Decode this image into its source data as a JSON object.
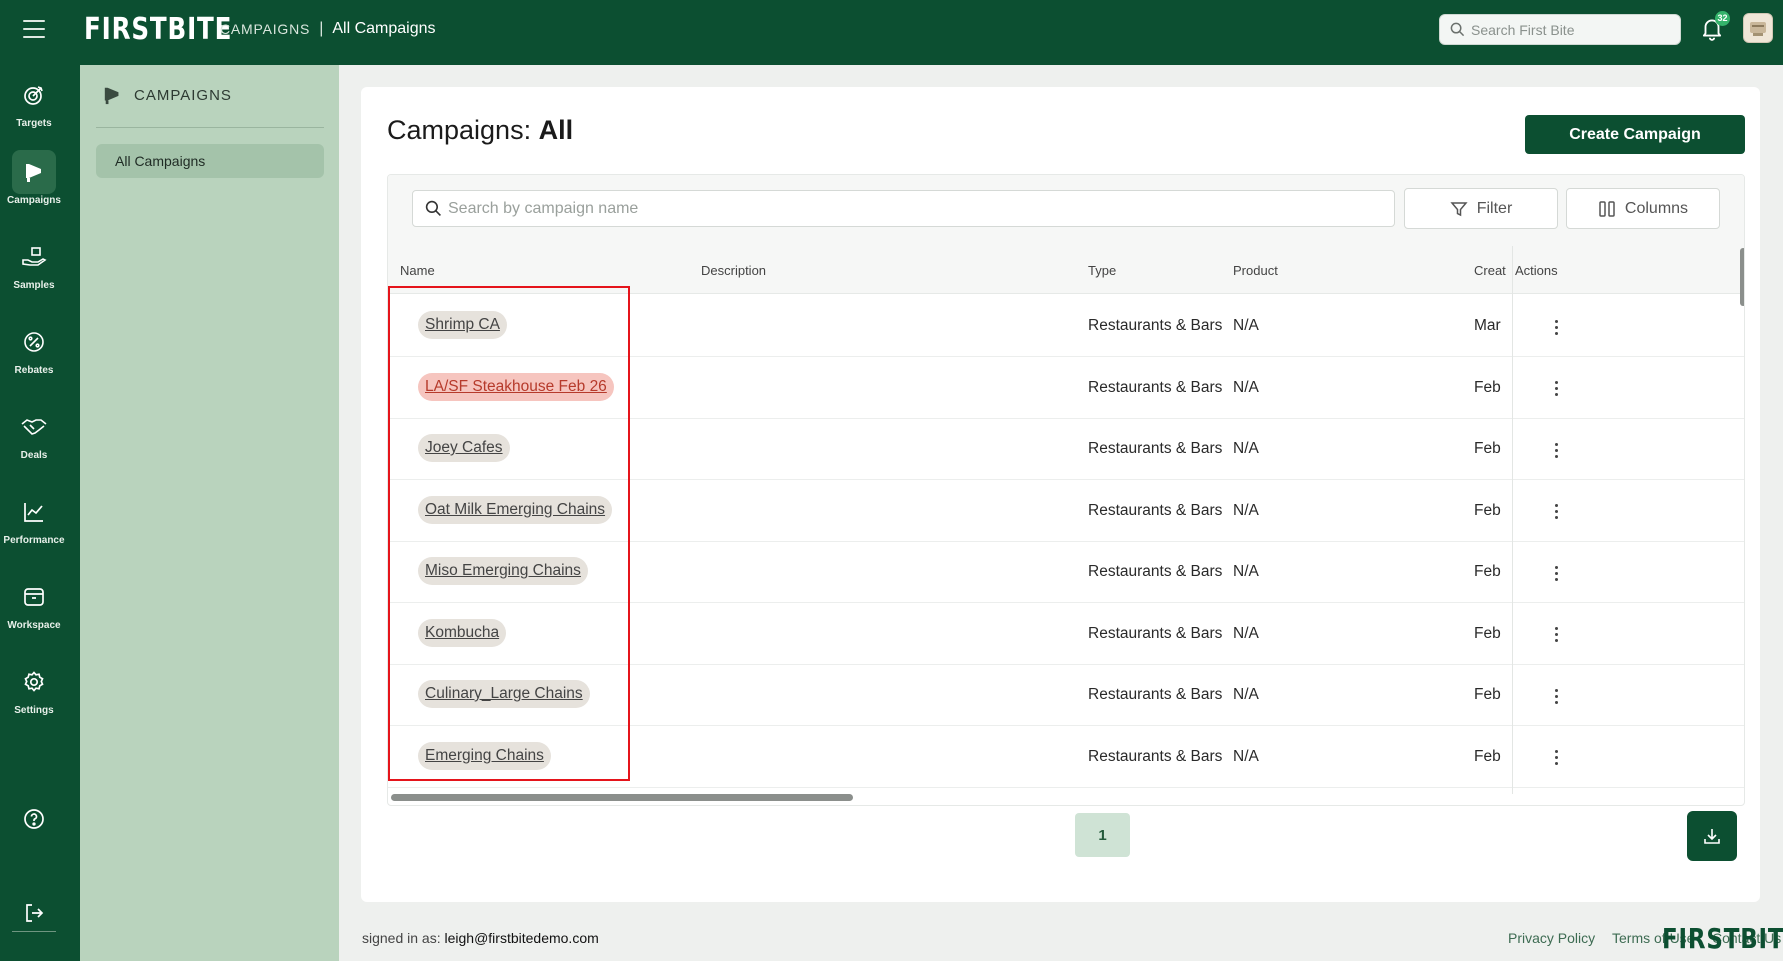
{
  "header": {
    "brand": "FIRSTBITE",
    "breadcrumb_section": "CAMPAIGNS",
    "breadcrumb_sep": "|",
    "breadcrumb_page": "All Campaigns",
    "search_placeholder": "Search First Bite",
    "notification_count": "32"
  },
  "rail": {
    "items": [
      {
        "label": "Targets",
        "icon": "target-icon"
      },
      {
        "label": "Campaigns",
        "icon": "megaphone-icon",
        "active": true
      },
      {
        "label": "Samples",
        "icon": "hand-box-icon"
      },
      {
        "label": "Rebates",
        "icon": "percent-badge-icon"
      },
      {
        "label": "Deals",
        "icon": "handshake-icon"
      },
      {
        "label": "Performance",
        "icon": "line-chart-icon"
      },
      {
        "label": "Workspace",
        "icon": "inbox-icon"
      },
      {
        "label": "Settings",
        "icon": "gear-icon"
      }
    ]
  },
  "subnav": {
    "heading": "CAMPAIGNS",
    "items": [
      {
        "label": "All Campaigns",
        "active": true
      }
    ]
  },
  "page": {
    "title_prefix": "Campaigns:",
    "title_strong": "All",
    "create_label": "Create Campaign",
    "search_placeholder": "Search by campaign name",
    "filter_label": "Filter",
    "columns_label": "Columns"
  },
  "table": {
    "headers": {
      "name": "Name",
      "description": "Description",
      "type": "Type",
      "product": "Product",
      "created": "Creat",
      "actions": "Actions"
    },
    "rows": [
      {
        "name": "Shrimp CA",
        "type": "Restaurants & Bars",
        "product": "N/A",
        "created": "Mar",
        "highlight": false
      },
      {
        "name": "LA/SF Steakhouse Feb 26",
        "type": "Restaurants & Bars",
        "product": "N/A",
        "created": "Feb",
        "highlight": true
      },
      {
        "name": "Joey Cafes",
        "type": "Restaurants & Bars",
        "product": "N/A",
        "created": "Feb",
        "highlight": false
      },
      {
        "name": "Oat Milk Emerging Chains",
        "type": "Restaurants & Bars",
        "product": "N/A",
        "created": "Feb",
        "highlight": false
      },
      {
        "name": "Miso Emerging Chains",
        "type": "Restaurants & Bars",
        "product": "N/A",
        "created": "Feb",
        "highlight": false
      },
      {
        "name": "Kombucha",
        "type": "Restaurants & Bars",
        "product": "N/A",
        "created": "Feb",
        "highlight": false
      },
      {
        "name": "Culinary_Large Chains",
        "type": "Restaurants & Bars",
        "product": "N/A",
        "created": "Feb",
        "highlight": false
      },
      {
        "name": "Emerging Chains",
        "type": "Restaurants & Bars",
        "product": "N/A",
        "created": "Feb",
        "highlight": false
      }
    ]
  },
  "pagination": {
    "current": "1"
  },
  "footer": {
    "signed_prefix": "signed in as:",
    "email": "leigh@firstbitedemo.com",
    "privacy": "Privacy Policy",
    "terms": "Terms of Use",
    "contact": "Contact Us",
    "brand": "FIRSTBITE"
  },
  "colors": {
    "primary": "#0c4f31",
    "sidebar": "#b9d3bd",
    "highlight_chip": "#f6c5bf",
    "annotation_border": "#e5141b"
  }
}
